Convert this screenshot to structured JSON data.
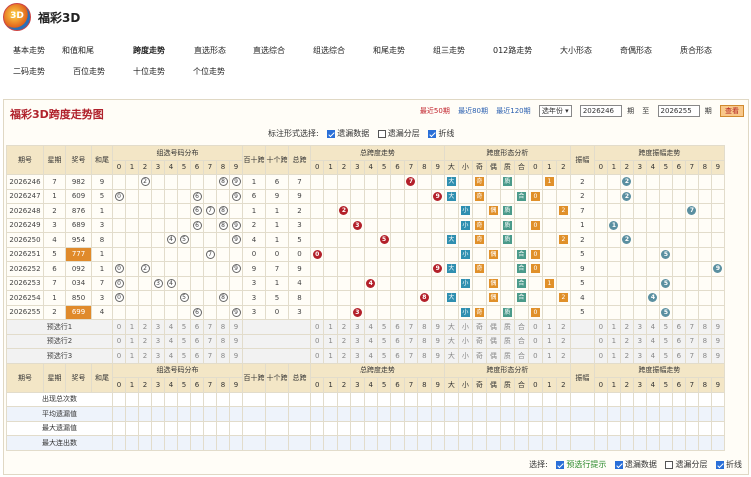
{
  "app": {
    "title": "福彩3D",
    "logo_text": "3D"
  },
  "nav": [
    [
      "基本走势",
      "和值和尾",
      "跨度走势",
      "直选形态",
      "直选综合",
      "组选综合",
      "和尾走势",
      "组三走势",
      "012路走势",
      "大小形态",
      "奇偶形态",
      "质合形态"
    ],
    [
      "二码走势",
      "百位走势",
      "十位走势",
      "个位走势"
    ]
  ],
  "nav_active": "跨度走势",
  "panel": {
    "title": "福彩3D跨度走势图",
    "recent50": "最近50期",
    "recent80": "最近80期",
    "recent120": "最近120期",
    "select_year": "选年份",
    "from_issue": "2026246",
    "period1": "期",
    "to": "至",
    "to_issue": "2026255",
    "period2": "期",
    "query": "查看"
  },
  "options": {
    "label": "标注形式选择:",
    "o1": "遗漏数据",
    "o2": "遗漏分层",
    "o3": "折线"
  },
  "headers": {
    "issue": "期号",
    "week": "星期",
    "prize": "奖号",
    "sum": "和尾",
    "g_dist": "组选号码分布",
    "hundred_ten": "百十跨",
    "ten_one": "十个跨",
    "total_span": "总跨",
    "total_trend": "总跨度走势",
    "shape": "跨度形态分析",
    "amp": "振幅",
    "amp_trend": "跨度振幅走势",
    "digits": [
      "0",
      "1",
      "2",
      "3",
      "4",
      "5",
      "6",
      "7",
      "8",
      "9"
    ],
    "shape_cols": [
      "大",
      "小",
      "奇",
      "偶",
      "质",
      "合",
      "0",
      "1",
      "2"
    ]
  },
  "rows": [
    {
      "issue": "2026246",
      "week": "7",
      "prize": "982",
      "sum": "9",
      "hs": "1",
      "to": "6",
      "span": "7",
      "amp": "2"
    },
    {
      "issue": "2026247",
      "week": "1",
      "prize": "609",
      "sum": "5",
      "hs": "6",
      "to": "9",
      "span": "9",
      "amp": "2"
    },
    {
      "issue": "2026248",
      "week": "2",
      "prize": "876",
      "sum": "1",
      "hs": "1",
      "to": "1",
      "span": "2",
      "amp": "7"
    },
    {
      "issue": "2026249",
      "week": "3",
      "prize": "689",
      "sum": "3",
      "hs": "2",
      "to": "1",
      "span": "3",
      "amp": "1"
    },
    {
      "issue": "2026250",
      "week": "4",
      "prize": "954",
      "sum": "8",
      "hs": "4",
      "to": "1",
      "span": "5",
      "amp": "2"
    },
    {
      "issue": "2026251",
      "week": "5",
      "prize": "777",
      "sum": "1",
      "hs": "0",
      "to": "0",
      "span": "0",
      "amp": "5"
    },
    {
      "issue": "2026252",
      "week": "6",
      "prize": "092",
      "sum": "1",
      "hs": "9",
      "to": "7",
      "span": "9",
      "amp": "9"
    },
    {
      "issue": "2026253",
      "week": "7",
      "prize": "034",
      "sum": "7",
      "hs": "3",
      "to": "1",
      "span": "4",
      "amp": "5"
    },
    {
      "issue": "2026254",
      "week": "1",
      "prize": "850",
      "sum": "3",
      "hs": "3",
      "to": "5",
      "span": "8",
      "amp": "4"
    },
    {
      "issue": "2026255",
      "week": "2",
      "prize": "699",
      "sum": "4",
      "hs": "3",
      "to": "0",
      "span": "3",
      "amp": "5"
    }
  ],
  "pre_rows": [
    "预选行1",
    "预选行2",
    "预选行3"
  ],
  "summary": [
    {
      "label": "出现总次数"
    },
    {
      "label": "平均遗漏值"
    },
    {
      "label": "最大遗漏值"
    },
    {
      "label": "最大连出数"
    }
  ],
  "footer": {
    "label": "选择:",
    "f1": "预选行提示",
    "f2": "遗漏数据",
    "f3": "遗漏分层",
    "f4": "折线"
  }
}
